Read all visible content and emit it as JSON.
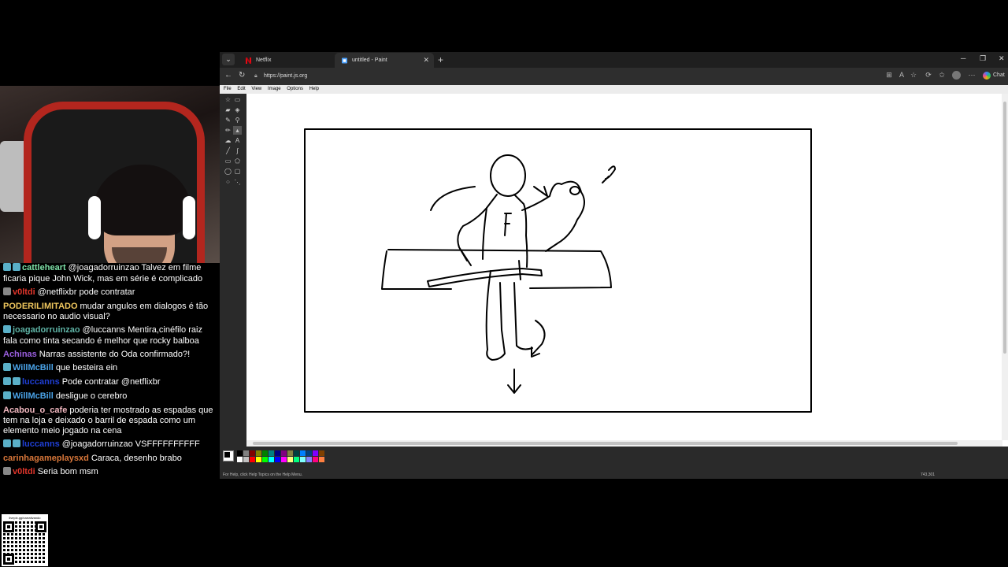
{
  "chat": {
    "messages": [
      {
        "user": "cattleheart",
        "color": "#7ee2a8",
        "badges": [
          "verified",
          "sub"
        ],
        "text": "@joagadorruinzao Talvez em filme ficaria pique John Wick, mas em série é complicado"
      },
      {
        "user": "v0ltdi",
        "color": "#e0352b",
        "badges": [
          "mod"
        ],
        "text": "@netflixbr pode contratar"
      },
      {
        "user": "PODERILIMITADO",
        "color": "#f0c75e",
        "badges": [],
        "text": "mudar angulos em dialogos é tão necessario no audio visual?"
      },
      {
        "user": "joagadorruinzao",
        "color": "#5fb4a6",
        "badges": [
          "verified"
        ],
        "text": "@luccanns Mentira,cinéfilo raiz fala como tinta secando é melhor que rocky balboa"
      },
      {
        "user": "Achinas",
        "color": "#9b5fe0",
        "badges": [],
        "text": "Narras assistente do Oda confirmado?!"
      },
      {
        "user": "WillMcBill",
        "color": "#4aa3e8",
        "badges": [
          "sub"
        ],
        "text": "que besteira ein"
      },
      {
        "user": "luccanns",
        "color": "#1f3fd6",
        "badges": [
          "verified",
          "sub"
        ],
        "text": "Pode contratar @netflixbr"
      },
      {
        "user": "WillMcBill",
        "color": "#4aa3e8",
        "badges": [
          "sub"
        ],
        "text": "desligue o cerebro"
      },
      {
        "user": "Acabou_o_cafe",
        "color": "#f2b8c0",
        "badges": [],
        "text": "poderia ter mostrado as espadas que tem na loja e deixado o barril de espada como um elemento meio jogado na cena"
      },
      {
        "user": "luccanns",
        "color": "#1f3fd6",
        "badges": [
          "verified",
          "sub"
        ],
        "text": "@joagadorruinzao VSFFFFFFFFFF"
      },
      {
        "user": "carinhagameplaysxd",
        "color": "#d9773a",
        "badges": [],
        "text": "Caraca, desenho brabo"
      },
      {
        "user": "v0ltdi",
        "color": "#e0352b",
        "badges": [
          "mod"
        ],
        "text": "Seria bom msm"
      }
    ]
  },
  "qr": {
    "label": "livepix.gg/narrativando"
  },
  "browser": {
    "tabs": [
      {
        "label": "Netflix",
        "icon": "netflix-icon",
        "color": "#e50914"
      },
      {
        "label": "untitled - Paint",
        "icon": "paint-icon",
        "color": "#4da3ff"
      }
    ],
    "url": "https://paint.js.org",
    "chat_label": "Chat"
  },
  "paint": {
    "menu": [
      "File",
      "Edit",
      "View",
      "Image",
      "Options",
      "Help"
    ],
    "status_text": "For Help, click Help Topics on the Help Menu.",
    "coords": "743,301",
    "palette": [
      "#000000",
      "#808080",
      "#800000",
      "#808000",
      "#008000",
      "#008080",
      "#000080",
      "#800080",
      "#808040",
      "#004040",
      "#0080ff",
      "#004080",
      "#8000ff",
      "#804000",
      "#ffffff",
      "#c0c0c0",
      "#ff0000",
      "#ffff00",
      "#00ff00",
      "#00ffff",
      "#0000ff",
      "#ff00ff",
      "#ffff80",
      "#00ff80",
      "#80ffff",
      "#8080ff",
      "#ff0080",
      "#ff8040"
    ]
  }
}
